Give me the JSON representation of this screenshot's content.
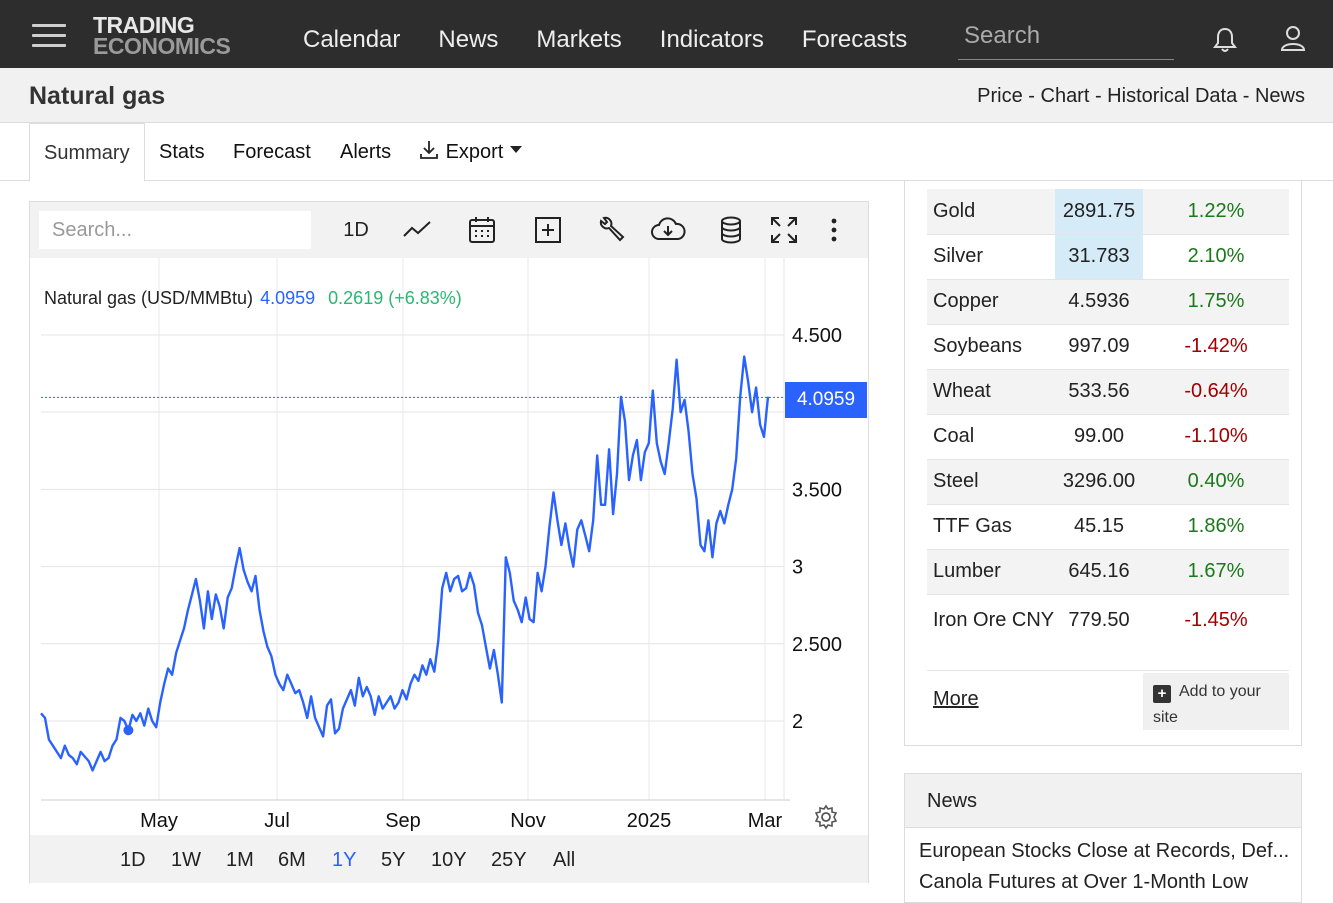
{
  "nav": {
    "logo_line1": "TRADING",
    "logo_line2": "ECONOMICS",
    "links": [
      "Calendar",
      "News",
      "Markets",
      "Indicators",
      "Forecasts"
    ],
    "search_placeholder": "Search"
  },
  "title": {
    "name": "Natural gas",
    "breadcrumb": "Price - Chart - Historical Data - News"
  },
  "tabs": [
    "Summary",
    "Stats",
    "Forecast",
    "Alerts",
    "Export"
  ],
  "chart_toolbar": {
    "search_placeholder": "Search...",
    "interval": "1D"
  },
  "chart_legend": {
    "name": "Natural gas (USD/MMBtu)",
    "price": "4.0959",
    "change": "0.2619 (+6.83%)"
  },
  "price_tag": "4.0959",
  "ranges": [
    "1D",
    "1W",
    "1M",
    "6M",
    "1Y",
    "5Y",
    "10Y",
    "25Y",
    "All"
  ],
  "active_range": "1Y",
  "colors": {
    "line": "#2962ff",
    "positive": "#1a7a1a",
    "negative": "#a00000",
    "nav_bg": "#2d2d2d"
  },
  "chart_data": {
    "type": "line",
    "title": "Natural gas (USD/MMBtu)",
    "y_ticks": [
      "4.500",
      "3.500",
      "3",
      "2.500",
      "2"
    ],
    "y_tick_values": [
      4.5,
      3.5,
      3.0,
      2.5,
      2.0
    ],
    "x_ticks": [
      "May",
      "Jul",
      "Sep",
      "Nov",
      "2025",
      "Mar"
    ],
    "ylim": [
      1.5,
      4.5
    ],
    "last_value": 4.0959,
    "series": [
      {
        "name": "Natural gas",
        "values": [
          2.05,
          2.02,
          1.88,
          1.84,
          1.8,
          1.76,
          1.84,
          1.78,
          1.76,
          1.72,
          1.8,
          1.77,
          1.74,
          1.68,
          1.74,
          1.8,
          1.74,
          1.76,
          1.84,
          1.88,
          2.02,
          2.0,
          1.94,
          2.04,
          2.0,
          2.05,
          1.97,
          2.08,
          2.0,
          1.96,
          2.12,
          2.24,
          2.34,
          2.3,
          2.44,
          2.52,
          2.6,
          2.72,
          2.82,
          2.92,
          2.78,
          2.6,
          2.84,
          2.66,
          2.82,
          2.74,
          2.6,
          2.8,
          2.86,
          3.0,
          3.12,
          2.98,
          2.9,
          2.84,
          2.94,
          2.72,
          2.58,
          2.48,
          2.42,
          2.3,
          2.24,
          2.2,
          2.3,
          2.24,
          2.18,
          2.2,
          2.12,
          2.02,
          2.16,
          2.02,
          1.96,
          1.9,
          2.1,
          2.14,
          1.92,
          1.95,
          2.08,
          2.14,
          2.2,
          2.1,
          2.28,
          2.16,
          2.22,
          2.16,
          2.04,
          2.16,
          2.08,
          2.12,
          2.16,
          2.08,
          2.12,
          2.2,
          2.14,
          2.24,
          2.3,
          2.26,
          2.36,
          2.3,
          2.4,
          2.32,
          2.52,
          2.86,
          2.96,
          2.84,
          2.92,
          2.94,
          2.84,
          2.86,
          2.96,
          2.88,
          2.7,
          2.62,
          2.48,
          2.34,
          2.46,
          2.3,
          2.12,
          3.06,
          2.96,
          2.78,
          2.72,
          2.64,
          2.8,
          2.66,
          2.64,
          2.96,
          2.84,
          3.0,
          3.26,
          3.48,
          3.3,
          3.14,
          3.28,
          3.12,
          3.0,
          3.24,
          3.3,
          3.2,
          3.1,
          3.3,
          3.72,
          3.4,
          3.4,
          3.76,
          3.34,
          3.6,
          4.1,
          3.94,
          3.56,
          3.72,
          3.82,
          3.56,
          3.74,
          3.8,
          4.14,
          3.8,
          3.68,
          3.6,
          3.8,
          4.02,
          4.34,
          4.0,
          4.08,
          3.88,
          3.6,
          3.44,
          3.14,
          3.1,
          3.3,
          3.06,
          3.28,
          3.36,
          3.28,
          3.4,
          3.5,
          3.7,
          4.1,
          4.36,
          4.2,
          4.0,
          4.16,
          3.92,
          3.84,
          4.1
        ]
      }
    ]
  },
  "commodities": [
    {
      "name": "Gold",
      "price": "2891.75",
      "change": "1.22%",
      "highlight": true
    },
    {
      "name": "Silver",
      "price": "31.783",
      "change": "2.10%",
      "highlight": true
    },
    {
      "name": "Copper",
      "price": "4.5936",
      "change": "1.75%"
    },
    {
      "name": "Soybeans",
      "price": "997.09",
      "change": "-1.42%"
    },
    {
      "name": "Wheat",
      "price": "533.56",
      "change": "-0.64%"
    },
    {
      "name": "Coal",
      "price": "99.00",
      "change": "-1.10%"
    },
    {
      "name": "Steel",
      "price": "3296.00",
      "change": "0.40%"
    },
    {
      "name": "TTF Gas",
      "price": "45.15",
      "change": "1.86%"
    },
    {
      "name": "Lumber",
      "price": "645.16",
      "change": "1.67%"
    },
    {
      "name": "Iron Ore CNY",
      "price": "779.50",
      "change": "-1.45%"
    }
  ],
  "commodities_more": "More",
  "add_to_site": "Add to your site",
  "news": {
    "heading": "News",
    "items": [
      "European Stocks Close at Records, Def...",
      "Canola Futures at Over 1-Month Low"
    ]
  }
}
